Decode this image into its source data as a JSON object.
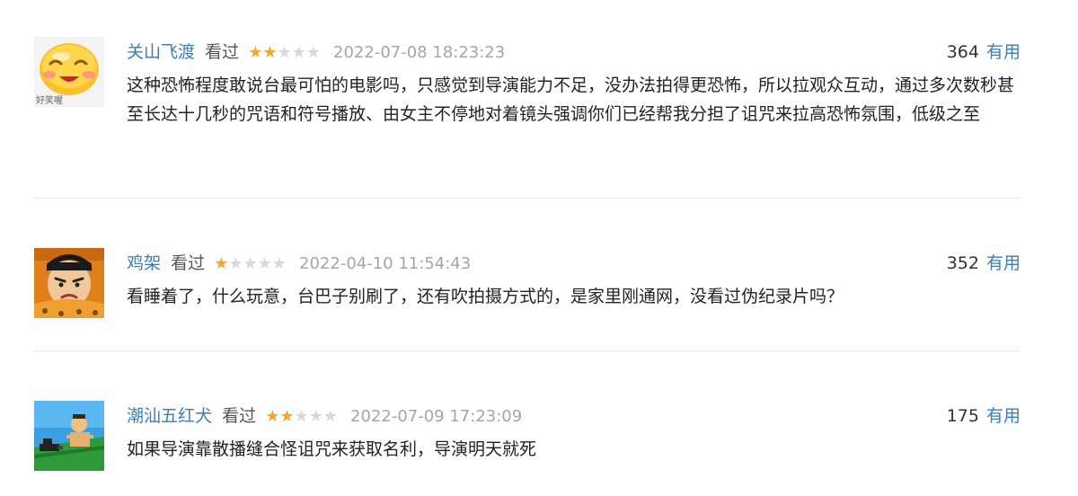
{
  "comments": [
    {
      "username": "关山飞渡",
      "status": "看过",
      "rating": 2,
      "timestamp": "2022-07-08 18:23:23",
      "votes": "364",
      "useful_label": "有用",
      "avatar_caption": "好笑喔",
      "text": "这种恐怖程度敢说台最可怕的电影吗，只感觉到导演能力不足，没办法拍得更恐怖，所以拉观众互动，通过多次数秒甚至长达十几秒的咒语和符号播放、由女主不停地对着镜头强调你们已经帮我分担了诅咒来拉高恐怖氛围，低级之至"
    },
    {
      "username": "鸡架",
      "status": "看过",
      "rating": 1,
      "timestamp": "2022-04-10 11:54:43",
      "votes": "352",
      "useful_label": "有用",
      "text": "看睡着了，什么玩意，台巴子别刷了，还有吹拍摄方式的，是家里刚通网，没看过伪纪录片吗？"
    },
    {
      "username": "潮汕五红犬",
      "status": "看过",
      "rating": 2,
      "timestamp": "2022-07-09 17:23:09",
      "votes": "175",
      "useful_label": "有用",
      "text": "如果导演靠散播缝合怪诅咒来获取名利，导演明天就死"
    }
  ],
  "colors": {
    "link": "#3d7db3",
    "star_on": "#f5a623",
    "star_off": "#d8d8d8",
    "timestamp": "#a5a5a5"
  }
}
